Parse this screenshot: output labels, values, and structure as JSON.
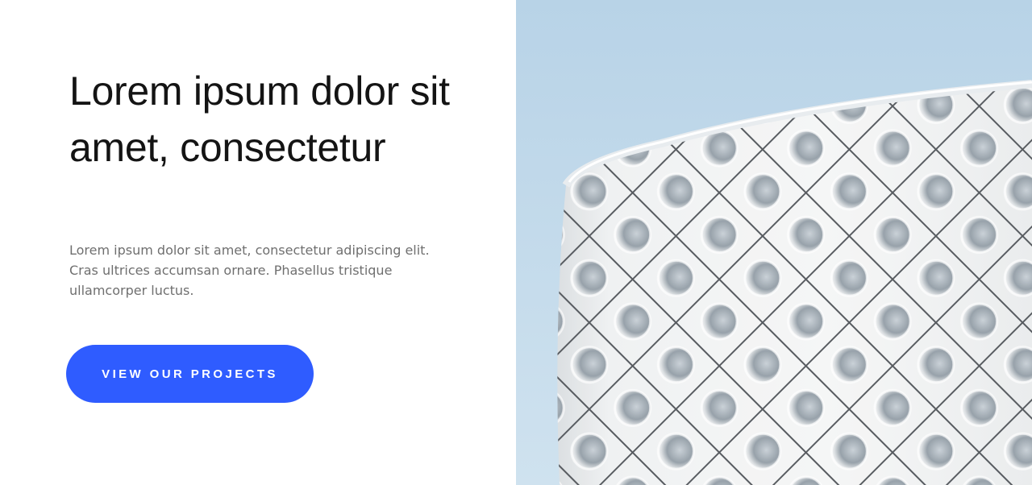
{
  "hero": {
    "headline": "Lorem ipsum dolor sit amet, consectetur",
    "body": "Lorem ipsum dolor sit amet, consectetur adipiscing elit. Cras ultrices accumsan ornare. Phasellus tristique ullamcorper luctus.",
    "cta_label": "VIEW OUR PROJECTS"
  },
  "colors": {
    "accent": "#2f5cff",
    "sky": "#bdd6e8",
    "heading": "#141414",
    "body_text": "#6f6f6f"
  },
  "image": {
    "subject": "architecture-photo"
  }
}
